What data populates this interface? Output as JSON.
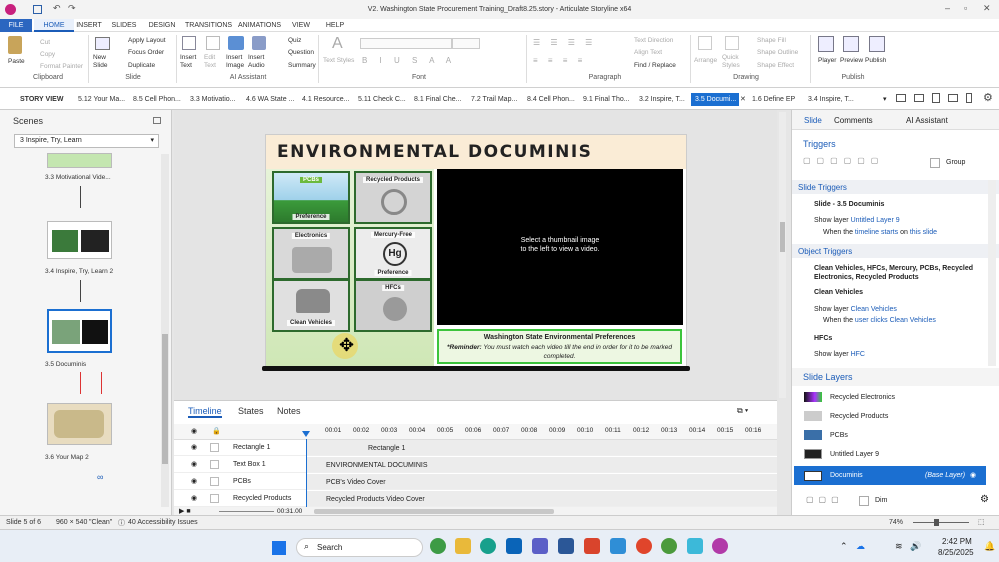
{
  "window": {
    "title": "V2. Washington State Procurement Training_Draft8.25.story - Articulate Storyline x64"
  },
  "menu": [
    "FILE",
    "HOME",
    "INSERT",
    "SLIDES",
    "DESIGN",
    "TRANSITIONS",
    "ANIMATIONS",
    "VIEW",
    "HELP"
  ],
  "ribbon": {
    "paste": "Paste",
    "cut": "Cut",
    "copy": "Copy",
    "format_painter": "Format Painter",
    "clipboard": "Clipboard",
    "new_slide": "New Slide",
    "apply_layout": "Apply Layout",
    "focus_order": "Focus Order",
    "duplicate": "Duplicate",
    "slide_group": "Slide",
    "insert_text": "Insert Text",
    "edit_text": "Edit Text",
    "insert_image": "Insert Image",
    "insert_audio": "Insert Audio",
    "ai_assistant": "AI Assistant",
    "quiz": "Quiz",
    "question": "Question",
    "summary": "Summary",
    "text_styles": "Text Styles",
    "font_group": "Font",
    "text_direction": "Text Direction",
    "align_text": "Align Text",
    "find_replace": "Find / Replace",
    "paragraph_group": "Paragraph",
    "arrange": "Arrange",
    "quick_styles": "Quick Styles",
    "shape_fill": "Shape Fill",
    "shape_outline": "Shape Outline",
    "shape_effect": "Shape Effect",
    "drawing_group": "Drawing",
    "player": "Player",
    "preview": "Preview",
    "publish": "Publish",
    "publish_group": "Publish"
  },
  "story_tabs": [
    "STORY VIEW",
    "5.12 Your Ma...",
    "8.5 Cell Phon...",
    "3.3 Motivatio...",
    "4.6 WA State ...",
    "4.1 Resource...",
    "5.11 Check C...",
    "8.1 Final Che...",
    "7.2 Trail Map...",
    "8.4 Cell Phon...",
    "9.1 Final Tho...",
    "3.2 Inspire, T...",
    "3.5 Documi...",
    "1.6 Define EP",
    "3.4 Inspire, T..."
  ],
  "scenes": {
    "title": "Scenes",
    "selected": "3 Inspire, Try, Learn",
    "thumbs": [
      "3.3 Motivational Vide...",
      "3.4 Inspire, Try, Learn 2",
      "3.5 Documinis",
      "3.6 Your Map 2"
    ]
  },
  "slide": {
    "title": "ENVIRONMENTAL DOCUMINIS",
    "cells": [
      {
        "label": "PCBs",
        "sub": "Preference"
      },
      {
        "label": "Recycled Products",
        "sub": ""
      },
      {
        "label": "Electronics",
        "sub": ""
      },
      {
        "label": "Mercury-Free",
        "sub": "Preference"
      },
      {
        "label": "Clean Vehicles",
        "sub": ""
      },
      {
        "label": "HFCs",
        "sub": ""
      }
    ],
    "video_msg1": "Select a thumbnail image",
    "video_msg2": "to the left to view a video.",
    "footer_title": "Washington State Environmental Preferences",
    "footer_reminder_label": "*Reminder:",
    "footer_reminder": "You must watch each video till the end in order for it to be marked completed."
  },
  "timeline": {
    "tabs": [
      "Timeline",
      "States",
      "Notes"
    ],
    "ticks": [
      "00:01",
      "00:02",
      "00:03",
      "00:04",
      "00:05",
      "00:06",
      "00:07",
      "00:08",
      "00:09",
      "00:10",
      "00:11",
      "00:12",
      "00:13",
      "00:14",
      "00:15",
      "00:16"
    ],
    "rows": [
      {
        "name": "Rectangle 1",
        "bar": "Rectangle 1"
      },
      {
        "name": "Text Box 1",
        "bar": "ENVIRONMENTAL DOCUMINIS"
      },
      {
        "name": "PCBs",
        "bar": "PCB's Video Cover"
      },
      {
        "name": "Recycled Products",
        "bar": "Recycled Products Video Cover"
      }
    ],
    "time": "00:31.00"
  },
  "right_panel": {
    "tabs": [
      "Slide",
      "Comments",
      "AI Assistant"
    ],
    "triggers": "Triggers",
    "group": "Group",
    "slide_triggers": "Slide Triggers",
    "slide_name": "Slide - 3.5 Documinis",
    "t1a": "Show layer",
    "t1b": "Untitled Layer 9",
    "t1c": "When the",
    "t1d": "timeline starts",
    "t1e": "on",
    "t1f": "this slide",
    "object_triggers": "Object Triggers",
    "obj_list": "Clean Vehicles, HFCs, Mercury, PCBs, Recycled Electronics, Recycled Products",
    "clean_vehicles": "Clean Vehicles",
    "t2a": "Show layer",
    "t2b": "Clean Vehicles",
    "t2c": "When the",
    "t2d": "user clicks",
    "t2e": "Clean Vehicles",
    "hfcs": "HFCs",
    "t3a": "Show layer",
    "t3b": "HFC",
    "slide_layers": "Slide Layers",
    "layers": [
      "Recycled Electronics",
      "Recycled Products",
      "PCBs",
      "Untitled Layer 9"
    ],
    "base_layer": "Documinis",
    "base_tag": "(Base Layer)",
    "dim": "Dim"
  },
  "status": {
    "slide": "Slide 5 of 6",
    "size": "960 × 540",
    "theme": "\"Clean\"",
    "accessibility": "40 Accessibility Issues",
    "zoom": "74%"
  },
  "taskbar": {
    "search": "Search",
    "time": "2:42 PM",
    "date": "8/25/2025"
  }
}
